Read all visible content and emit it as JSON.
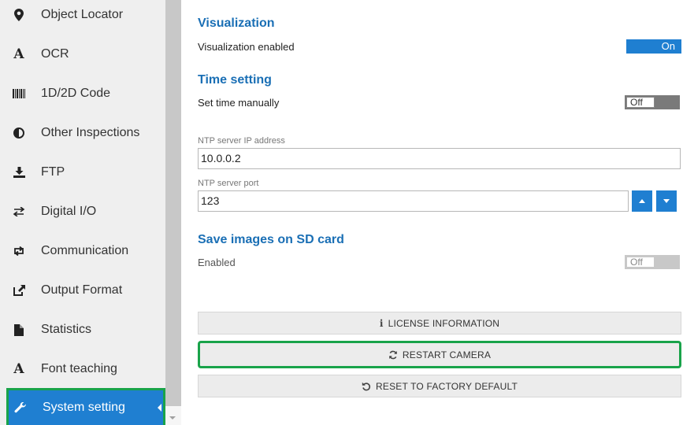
{
  "sidebar": {
    "items": [
      {
        "label": "Object Locator",
        "icon": "map-marker-icon"
      },
      {
        "label": "OCR",
        "icon": "font-icon"
      },
      {
        "label": "1D/2D Code",
        "icon": "barcode-icon"
      },
      {
        "label": "Other Inspections",
        "icon": "contrast-icon"
      },
      {
        "label": "FTP",
        "icon": "download-icon"
      },
      {
        "label": "Digital I/O",
        "icon": "exchange-icon"
      },
      {
        "label": "Communication",
        "icon": "retweet-icon"
      },
      {
        "label": "Output Format",
        "icon": "share-icon"
      },
      {
        "label": "Statistics",
        "icon": "file-icon"
      },
      {
        "label": "Font teaching",
        "icon": "font-icon"
      },
      {
        "label": "System setting",
        "icon": "wrench-icon",
        "active": true
      }
    ]
  },
  "visualization": {
    "title": "Visualization",
    "enabled_label": "Visualization enabled",
    "toggle_label": "On"
  },
  "time_setting": {
    "title": "Time setting",
    "manual_label": "Set time manually",
    "toggle_label": "Off",
    "ntp_ip_label": "NTP server IP address",
    "ntp_ip_value": "10.0.0.2",
    "ntp_port_label": "NTP server port",
    "ntp_port_value": "123"
  },
  "sd_card": {
    "title": "Save images on SD card",
    "enabled_label": "Enabled",
    "toggle_label": "Off"
  },
  "actions": {
    "license": "LICENSE INFORMATION",
    "restart": "RESTART CAMERA",
    "reset": "RESET TO FACTORY DEFAULT"
  },
  "colors": {
    "accent": "#1f7fd1",
    "title_blue": "#1a6fb5",
    "highlight_green": "#19a34a"
  }
}
